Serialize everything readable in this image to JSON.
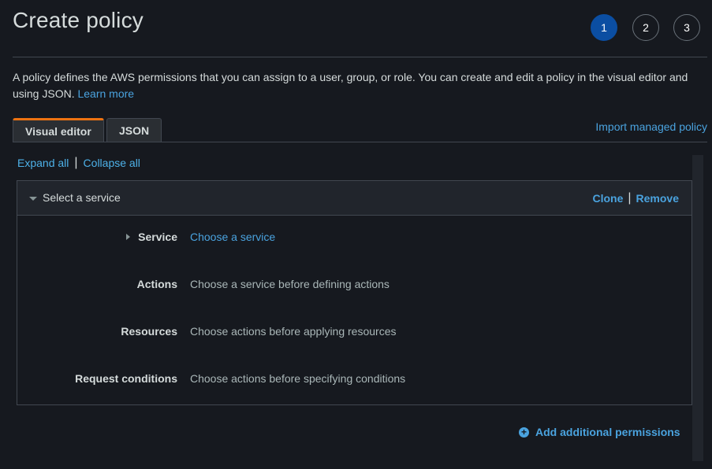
{
  "header": {
    "title": "Create policy",
    "steps": [
      "1",
      "2",
      "3"
    ],
    "active_step": "1"
  },
  "description": {
    "text": "A policy defines the AWS permissions that you can assign to a user, group, or role. You can create and edit a policy in the visual editor and using JSON.",
    "learn_more": "Learn more"
  },
  "tabs": [
    {
      "label": "Visual editor",
      "active": true
    },
    {
      "label": "JSON",
      "active": false
    }
  ],
  "import_link": "Import managed policy",
  "expand_controls": {
    "expand": "Expand all",
    "separator": "|",
    "collapse": "Collapse all"
  },
  "statement": {
    "title": "Select a service",
    "actions": {
      "clone": "Clone",
      "separator": "|",
      "remove": "Remove"
    },
    "rows": [
      {
        "label": "Service",
        "value": "Choose a service"
      },
      {
        "label": "Actions",
        "value": "Choose a service before defining actions"
      },
      {
        "label": "Resources",
        "value": "Choose actions before applying resources"
      },
      {
        "label": "Request conditions",
        "value": "Choose actions before specifying conditions"
      }
    ]
  },
  "add_permissions": "Add additional permissions",
  "colors": {
    "background": "#16191f",
    "accent_tab": "#ec7211",
    "link": "#4aa3df",
    "active_step": "#0b4ea2"
  },
  "icons": [
    "caret-down-icon",
    "caret-right-icon",
    "plus-circle-icon"
  ]
}
